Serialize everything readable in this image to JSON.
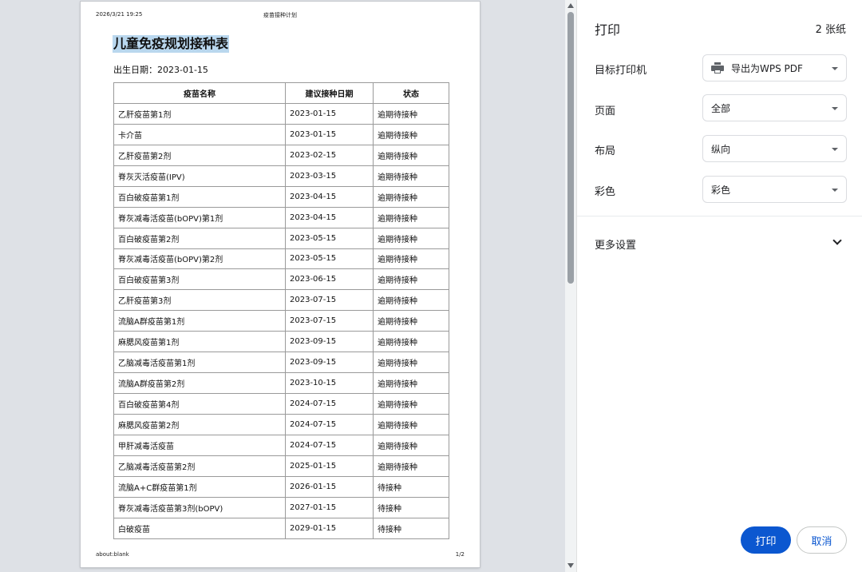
{
  "preview": {
    "header_datetime": "2026/3/21 19:25",
    "header_title": "疫苗接种计划",
    "footer_url": "about:blank",
    "footer_page": "1/2",
    "doc_title": "儿童免疫规划接种表",
    "dob_label": "出生日期：",
    "dob_value": "2023-01-15",
    "table": {
      "headers": [
        "疫苗名称",
        "建议接种日期",
        "状态"
      ],
      "rows": [
        [
          "乙肝疫苗第1剂",
          "2023-01-15",
          "逾期待接种"
        ],
        [
          "卡介苗",
          "2023-01-15",
          "逾期待接种"
        ],
        [
          "乙肝疫苗第2剂",
          "2023-02-15",
          "逾期待接种"
        ],
        [
          "脊灰灭活疫苗(IPV)",
          "2023-03-15",
          "逾期待接种"
        ],
        [
          "百白破疫苗第1剂",
          "2023-04-15",
          "逾期待接种"
        ],
        [
          "脊灰减毒活疫苗(bOPV)第1剂",
          "2023-04-15",
          "逾期待接种"
        ],
        [
          "百白破疫苗第2剂",
          "2023-05-15",
          "逾期待接种"
        ],
        [
          "脊灰减毒活疫苗(bOPV)第2剂",
          "2023-05-15",
          "逾期待接种"
        ],
        [
          "百白破疫苗第3剂",
          "2023-06-15",
          "逾期待接种"
        ],
        [
          "乙肝疫苗第3剂",
          "2023-07-15",
          "逾期待接种"
        ],
        [
          "流脑A群疫苗第1剂",
          "2023-07-15",
          "逾期待接种"
        ],
        [
          "麻腮风疫苗第1剂",
          "2023-09-15",
          "逾期待接种"
        ],
        [
          "乙脑减毒活疫苗第1剂",
          "2023-09-15",
          "逾期待接种"
        ],
        [
          "流脑A群疫苗第2剂",
          "2023-10-15",
          "逾期待接种"
        ],
        [
          "百白破疫苗第4剂",
          "2024-07-15",
          "逾期待接种"
        ],
        [
          "麻腮风疫苗第2剂",
          "2024-07-15",
          "逾期待接种"
        ],
        [
          "甲肝减毒活疫苗",
          "2024-07-15",
          "逾期待接种"
        ],
        [
          "乙脑减毒活疫苗第2剂",
          "2025-01-15",
          "逾期待接种"
        ],
        [
          "流脑A+C群疫苗第1剂",
          "2026-01-15",
          "待接种"
        ],
        [
          "脊灰减毒活疫苗第3剂(bOPV)",
          "2027-01-15",
          "待接种"
        ],
        [
          "白破疫苗",
          "2029-01-15",
          "待接种"
        ]
      ]
    }
  },
  "settings": {
    "title": "打印",
    "sheet_count": "2 张纸",
    "printer_label": "目标打印机",
    "printer_value": "导出为WPS PDF",
    "pages_label": "页面",
    "pages_value": "全部",
    "layout_label": "布局",
    "layout_value": "纵向",
    "color_label": "彩色",
    "color_value": "彩色",
    "more_settings": "更多设置",
    "print_button": "打印",
    "cancel_button": "取消"
  },
  "icons": {
    "printer": "printer-icon",
    "chevron": "chevron-down-icon",
    "caret": "dropdown-caret-icon"
  },
  "colors": {
    "accent": "#0b57d0",
    "title_highlight": "#b9d7ee",
    "preview_background": "#dee1e6"
  }
}
